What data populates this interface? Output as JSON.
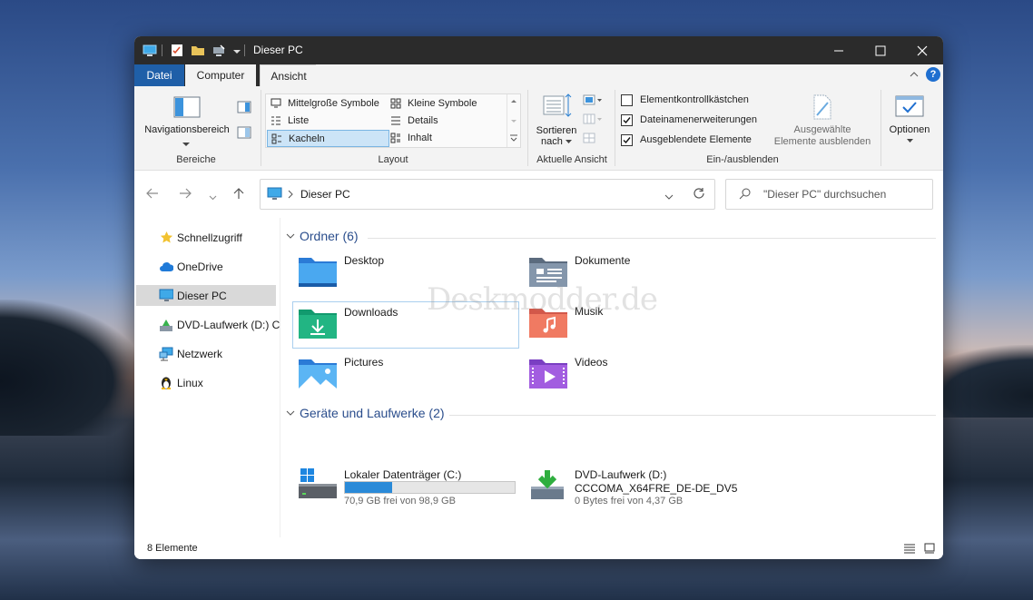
{
  "window": {
    "title": "Dieser PC"
  },
  "tabs": {
    "file": "Datei",
    "computer": "Computer",
    "view": "Ansicht"
  },
  "ribbon": {
    "panes": {
      "navigation_pane": "Navigationsbereich",
      "label": "Bereiche"
    },
    "layout": {
      "label": "Layout",
      "items": [
        "Mittelgroße Symbole",
        "Kleine Symbole",
        "Liste",
        "Details",
        "Kacheln",
        "Inhalt"
      ],
      "selected": "Kacheln"
    },
    "current_view": {
      "sort_line1": "Sortieren",
      "sort_line2": "nach",
      "label": "Aktuelle Ansicht"
    },
    "show_hide": {
      "label": "Ein-/ausblenden",
      "checkboxes": [
        {
          "label": "Elementkontrollkästchen",
          "checked": false
        },
        {
          "label": "Dateinamenerweiterungen",
          "checked": true
        },
        {
          "label": "Ausgeblendete Elemente",
          "checked": true
        }
      ],
      "hide_selected_line1": "Ausgewählte",
      "hide_selected_line2": "Elemente ausblenden"
    },
    "options": "Optionen"
  },
  "nav": {
    "breadcrumb": "Dieser PC",
    "search_placeholder": "\"Dieser PC\" durchsuchen"
  },
  "sidebar": {
    "items": [
      "Schnellzugriff",
      "OneDrive",
      "Dieser PC",
      "DVD-Laufwerk (D:) C",
      "Netzwerk",
      "Linux"
    ],
    "selected": "Dieser PC"
  },
  "content": {
    "folders_header": "Ordner (6)",
    "folders": [
      "Desktop",
      "Dokumente",
      "Downloads",
      "Musik",
      "Pictures",
      "Videos"
    ],
    "drives_header": "Geräte und Laufwerke (2)",
    "drives": [
      {
        "name": "Lokaler Datenträger (C:)",
        "detail": "",
        "free": "70,9 GB frei von 98,9 GB",
        "used_fraction": 0.28
      },
      {
        "name": "DVD-Laufwerk (D:)",
        "detail": "CCCOMA_X64FRE_DE-DE_DV5",
        "free": "0 Bytes frei von 4,37 GB"
      }
    ],
    "watermark": "Deskmodder.de"
  },
  "status": {
    "count": "8 Elemente"
  },
  "colors": {
    "accent": "#1f5fa8",
    "titlebar": "#2b2b2b",
    "bar": "#2a8ad8"
  }
}
